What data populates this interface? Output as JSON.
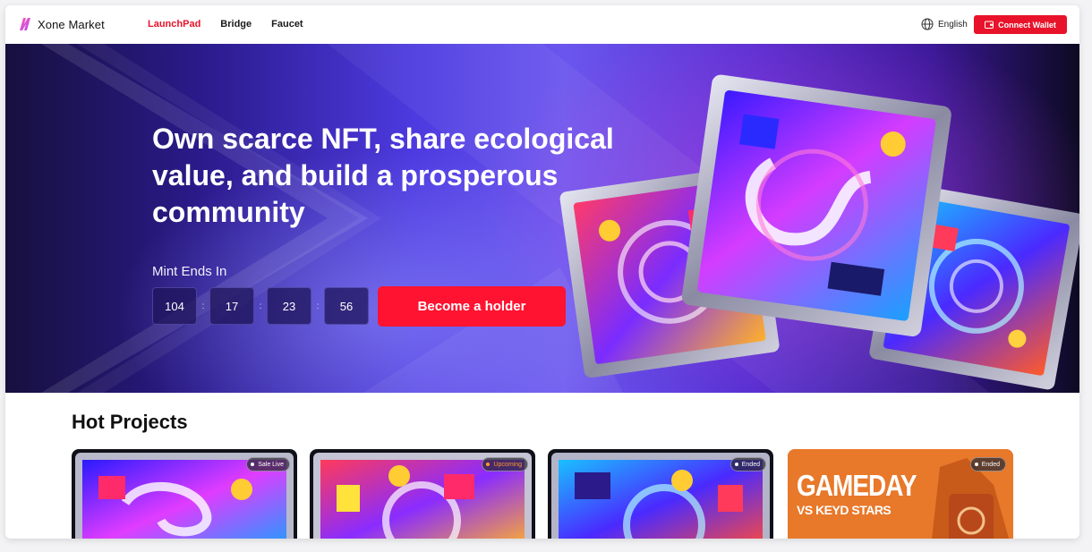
{
  "brand": {
    "name": "Xone Market",
    "logo": "xone-logo"
  },
  "nav": {
    "links": [
      {
        "label": "LaunchPad",
        "active": true
      },
      {
        "label": "Bridge",
        "active": false
      },
      {
        "label": "Faucet",
        "active": false
      }
    ]
  },
  "header": {
    "language": "English",
    "language_icon": "globe-icon",
    "connect_label": "Connect Wallet",
    "connect_icon": "wallet-icon"
  },
  "hero": {
    "title": "Own scarce NFT, share ecological value, and build a prosperous community",
    "mint_label": "Mint Ends In",
    "countdown": [
      "104",
      "17",
      "23",
      "56"
    ],
    "cta_label": "Become a holder"
  },
  "hot_projects": {
    "title": "Hot Projects",
    "cards": [
      {
        "status": "Sale Live"
      },
      {
        "status": "Upcoming"
      },
      {
        "status": "Ended"
      },
      {
        "status": "Ended",
        "headline": "GAMEDAY",
        "subline": "VS KEYD STARS"
      }
    ]
  },
  "colors": {
    "accent": "#e8132a",
    "cta": "#ff1330",
    "hero_purple": "#4d3ae0",
    "upcoming": "#ff9a2a",
    "gameday_orange": "#e8782a"
  }
}
